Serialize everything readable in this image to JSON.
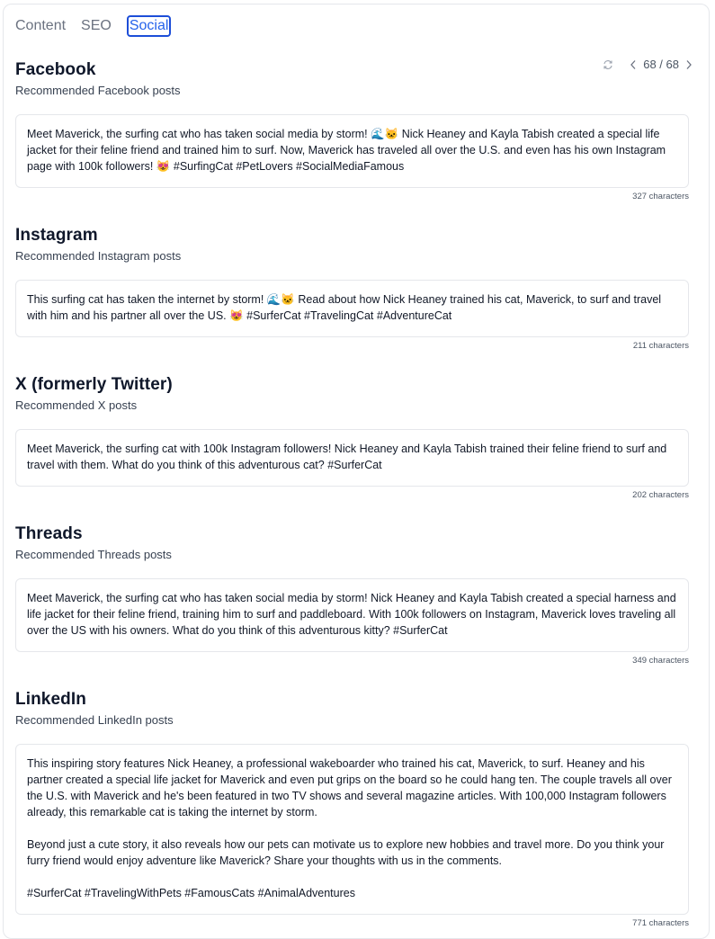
{
  "tabs": [
    {
      "label": "Content"
    },
    {
      "label": "SEO"
    },
    {
      "label": "Social"
    }
  ],
  "pager": {
    "text": "68 / 68"
  },
  "sections": [
    {
      "title": "Facebook",
      "subtitle": "Recommended Facebook posts",
      "post": "Meet Maverick, the surfing cat who has taken social media by storm! 🌊🐱 Nick Heaney and Kayla Tabish created a special life jacket for their feline friend and trained him to surf. Now, Maverick has traveled all over the U.S. and even has his own Instagram page with 100k followers! 😻 #SurfingCat #PetLovers #SocialMediaFamous",
      "chars": "327 characters"
    },
    {
      "title": "Instagram",
      "subtitle": "Recommended Instagram posts",
      "post": "This surfing cat has taken the internet by storm! 🌊🐱 Read about how Nick Heaney trained his cat, Maverick, to surf and travel with him and his partner all over the US. 😻 #SurferCat #TravelingCat #AdventureCat",
      "chars": "211 characters"
    },
    {
      "title": "X (formerly Twitter)",
      "subtitle": "Recommended X posts",
      "post": "Meet Maverick, the surfing cat with 100k Instagram followers! Nick Heaney and Kayla Tabish trained their feline friend to surf and travel with them. What do you think of this adventurous cat? #SurferCat",
      "chars": "202 characters"
    },
    {
      "title": "Threads",
      "subtitle": "Recommended Threads posts",
      "post": "Meet Maverick, the surfing cat who has taken social media by storm! Nick Heaney and Kayla Tabish created a special harness and life jacket for their feline friend, training him to surf and paddleboard. With 100k followers on Instagram, Maverick loves traveling all over the US with his owners. What do you think of this adventurous kitty? #SurferCat",
      "chars": "349 characters"
    },
    {
      "title": "LinkedIn",
      "subtitle": "Recommended LinkedIn posts",
      "post": "This inspiring story features Nick Heaney, a professional wakeboarder who trained his cat, Maverick, to surf. Heaney and his partner created a special life jacket for Maverick and even put grips on the board so he could hang ten. The couple travels all over the U.S. with Maverick and he's been featured in two TV shows and several magazine articles. With 100,000 Instagram followers already, this remarkable cat is taking the internet by storm.\n\nBeyond just a cute story, it also reveals how our pets can motivate us to explore new hobbies and travel more. Do you think your furry friend would enjoy adventure like Maverick? Share your thoughts with us in the comments.\n\n#SurferCat #TravelingWithPets #FamousCats #AnimalAdventures",
      "chars": "771 characters"
    }
  ]
}
